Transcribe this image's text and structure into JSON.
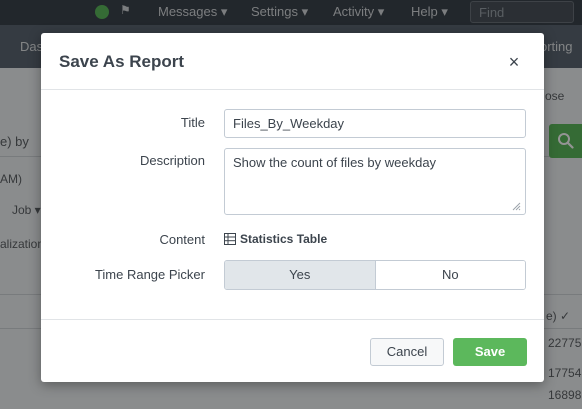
{
  "topbar": {
    "activity_glyph": "⚑",
    "menus": [
      "Messages ▾",
      "Settings ▾",
      "Activity ▾",
      "Help ▾"
    ],
    "find_placeholder": "Find"
  },
  "background": {
    "appbar_left": "Das",
    "appbar_right": "orting",
    "close_fragment": "ose",
    "search_fragment": "e)  by",
    "time_fragment": "AM)",
    "job_fragment": "Job ▾",
    "viz_fragment": "alization",
    "col_fragment": "e)  ✓",
    "rows": [
      "22775",
      "17754",
      "16898"
    ]
  },
  "modal": {
    "title": "Save As Report",
    "close_glyph": "×",
    "fields": {
      "title_label": "Title",
      "title_value": "Files_By_Weekday",
      "description_label": "Description",
      "description_value": "Show the count of files by weekday",
      "content_label": "Content",
      "content_value": "Statistics Table",
      "time_range_label": "Time Range Picker",
      "yes_label": "Yes",
      "no_label": "No"
    },
    "buttons": {
      "cancel": "Cancel",
      "save": "Save"
    }
  },
  "colors": {
    "accent_green": "#5cb85c",
    "topbar": "#3c444d",
    "appbar": "#5c6773"
  }
}
